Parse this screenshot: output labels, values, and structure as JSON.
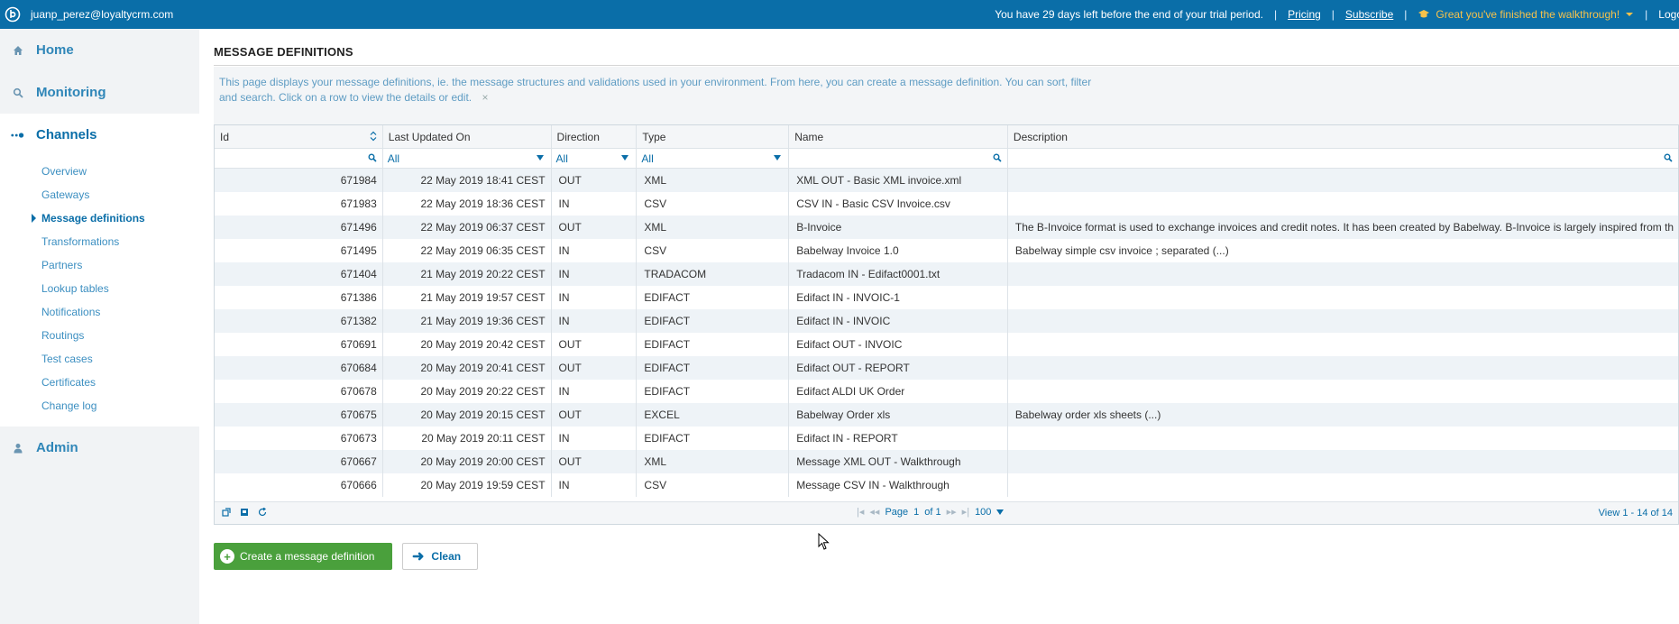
{
  "topbar": {
    "user_email": "juanp_perez@loyaltycrm.com",
    "trial_message": "You have 29 days left before the end of your trial period.",
    "pricing": "Pricing",
    "subscribe": "Subscribe",
    "walkthrough": "Great you've finished the walkthrough!",
    "logout": "Logo"
  },
  "sidebar": {
    "home": "Home",
    "monitoring": "Monitoring",
    "channels": "Channels",
    "admin": "Admin",
    "channel_items": [
      "Overview",
      "Gateways",
      "Message definitions",
      "Transformations",
      "Partners",
      "Lookup tables",
      "Notifications",
      "Routings",
      "Test cases",
      "Certificates",
      "Change log"
    ]
  },
  "page": {
    "title": "MESSAGE DEFINITIONS",
    "info_line1": "This page displays your message definitions, ie. the message structures and validations used in your environment. From here, you can create a message definition. You can sort, filter",
    "info_line2": "and search. Click on a row to view the details or edit.",
    "info_close": "×"
  },
  "grid": {
    "columns": [
      "Id",
      "Last Updated On",
      "Direction",
      "Type",
      "Name",
      "Description"
    ],
    "filters": {
      "date": "All",
      "direction": "All",
      "type": "All"
    },
    "rows": [
      [
        "671984",
        "22 May 2019 18:41 CEST",
        "OUT",
        "XML",
        "XML OUT - Basic XML invoice.xml",
        ""
      ],
      [
        "671983",
        "22 May 2019 18:36 CEST",
        "IN",
        "CSV",
        "CSV IN - Basic CSV Invoice.csv",
        ""
      ],
      [
        "671496",
        "22 May 2019 06:37 CEST",
        "OUT",
        "XML",
        "B-Invoice",
        "The B-Invoice format is used to exchange invoices and credit notes. It has been created by Babelway. B-Invoice is largely inspired from th"
      ],
      [
        "671495",
        "22 May 2019 06:35 CEST",
        "IN",
        "CSV",
        "Babelway  Invoice 1.0",
        "Babelway simple csv invoice ; separated (...)"
      ],
      [
        "671404",
        "21 May 2019 20:22 CEST",
        "IN",
        "TRADACOM",
        "Tradacom IN - Edifact0001.txt",
        ""
      ],
      [
        "671386",
        "21 May 2019 19:57 CEST",
        "IN",
        "EDIFACT",
        "Edifact IN - INVOIC-1",
        ""
      ],
      [
        "671382",
        "21 May 2019 19:36 CEST",
        "IN",
        "EDIFACT",
        "Edifact IN - INVOIC",
        ""
      ],
      [
        "670691",
        "20 May 2019 20:42 CEST",
        "OUT",
        "EDIFACT",
        "Edifact OUT - INVOIC",
        ""
      ],
      [
        "670684",
        "20 May 2019 20:41 CEST",
        "OUT",
        "EDIFACT",
        "Edifact OUT - REPORT",
        ""
      ],
      [
        "670678",
        "20 May 2019 20:22 CEST",
        "IN",
        "EDIFACT",
        "Edifact ALDI UK Order",
        ""
      ],
      [
        "670675",
        "20 May 2019 20:15 CEST",
        "OUT",
        "EXCEL",
        "Babelway Order xls",
        "Babelway order xls sheets (...)"
      ],
      [
        "670673",
        "20 May 2019 20:11 CEST",
        "IN",
        "EDIFACT",
        "Edifact IN - REPORT",
        ""
      ],
      [
        "670667",
        "20 May 2019 20:00 CEST",
        "OUT",
        "XML",
        "Message XML OUT - Walkthrough",
        ""
      ],
      [
        "670666",
        "20 May 2019 19:59 CEST",
        "IN",
        "CSV",
        "Message CSV IN - Walkthrough",
        ""
      ]
    ],
    "pager": {
      "page_label": "Page",
      "page_value": "1",
      "of_label": "of 1",
      "page_size": "100",
      "view_info": "View 1 - 14 of 14"
    }
  },
  "buttons": {
    "create": "Create a message definition",
    "clean": "Clean"
  },
  "colors": {
    "topbar": "#0a6ea8",
    "accent": "#0a6ea8",
    "create_button": "#4aa03c",
    "walkthrough": "#f6c24b"
  }
}
